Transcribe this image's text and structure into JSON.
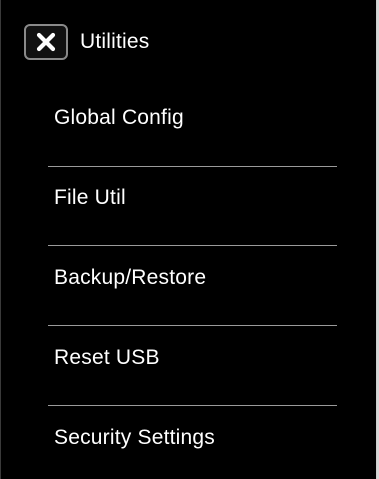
{
  "header": {
    "title": "Utilities",
    "close_icon": "close-x-icon"
  },
  "menu": {
    "items": [
      {
        "label": "Global Config"
      },
      {
        "label": "File Util"
      },
      {
        "label": "Backup/Restore"
      },
      {
        "label": "Reset USB"
      },
      {
        "label": "Security Settings"
      }
    ]
  },
  "colors": {
    "background": "#000000",
    "text": "#ffffff",
    "divider": "#9a9a9a",
    "button_border": "#8a8a8a"
  }
}
